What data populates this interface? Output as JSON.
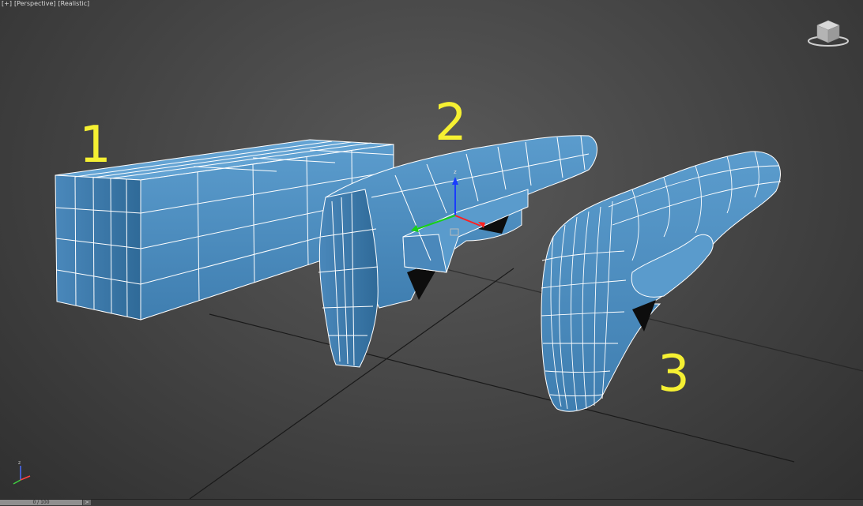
{
  "viewport": {
    "label_parts": [
      "[+]",
      "[Perspective]",
      "[Realistic]"
    ],
    "view_cube_icon": "view-cube-icon",
    "gizmo_axes": [
      "x",
      "y",
      "z"
    ],
    "axis_tripod_icon": "axis-tripod-icon"
  },
  "objects": [
    {
      "label": "1"
    },
    {
      "label": "2"
    },
    {
      "label": "3"
    }
  ],
  "colors": {
    "mesh": "#4f8fbf",
    "mesh_shade": "#3f78a6",
    "wire": "#ffffff",
    "label": "#f5f032",
    "grid": "#1a1a1a"
  },
  "timeline": {
    "frame": "0 / 100",
    "next_label": ">"
  }
}
